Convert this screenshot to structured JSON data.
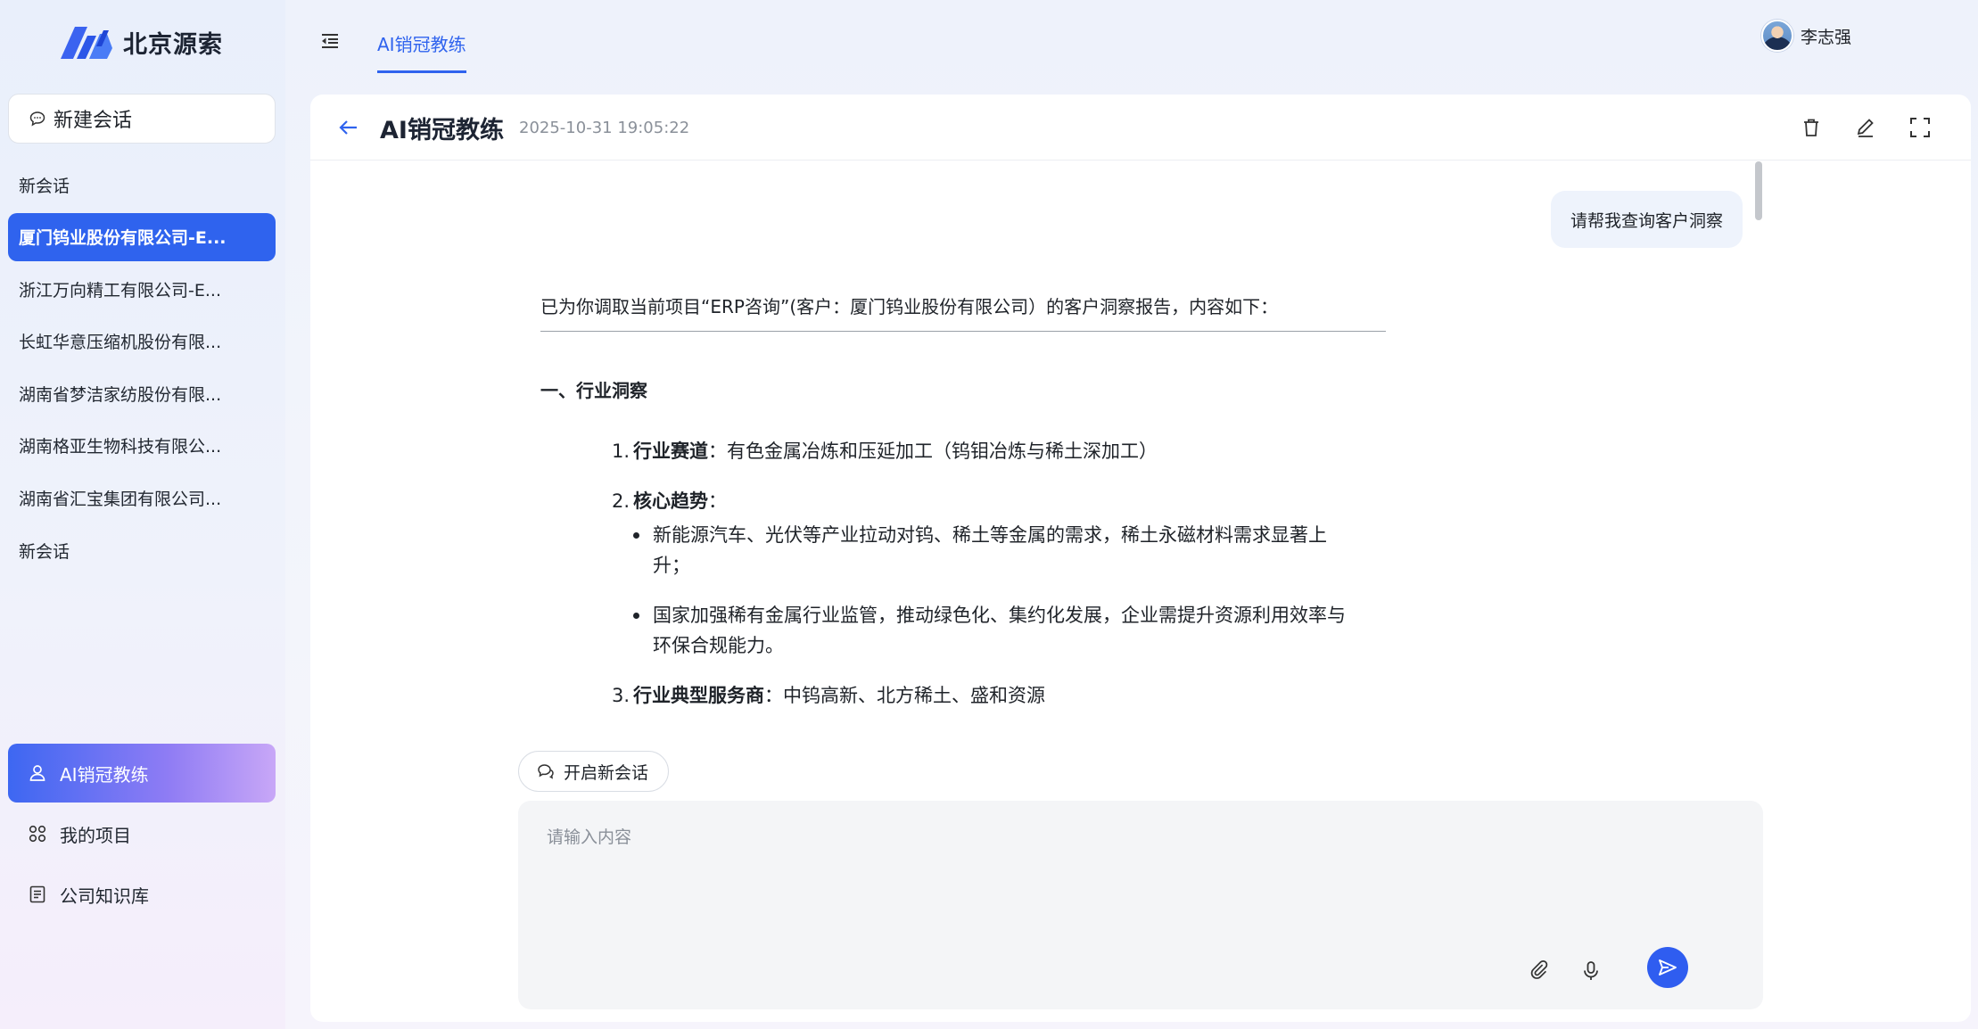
{
  "brand": {
    "name": "北京源索",
    "accent": "#2f63ee"
  },
  "sidebar": {
    "new_chat_label": "新建会话",
    "history": [
      {
        "label": "新会话",
        "active": false
      },
      {
        "label": "厦门钨业股份有限公司-E...",
        "active": true
      },
      {
        "label": "浙江万向精工有限公司-E...",
        "active": false
      },
      {
        "label": "长虹华意压缩机股份有限...",
        "active": false
      },
      {
        "label": "湖南省梦洁家纺股份有限...",
        "active": false
      },
      {
        "label": "湖南格亚生物科技有限公...",
        "active": false
      },
      {
        "label": "湖南省汇宝集团有限公司...",
        "active": false
      },
      {
        "label": "新会话",
        "active": false
      }
    ],
    "nav": [
      {
        "label": "AI销冠教练",
        "icon": "user-icon",
        "active": true
      },
      {
        "label": "我的项目",
        "icon": "grid-icon",
        "active": false
      },
      {
        "label": "公司知识库",
        "icon": "book-icon",
        "active": false
      }
    ]
  },
  "topbar": {
    "tab_label": "AI销冠教练",
    "user_name": "李志强"
  },
  "panel": {
    "title": "AI销冠教练",
    "timestamp": "2025-10-31 19:05:22"
  },
  "conversation": {
    "user_message": "请帮我查询客户洞察",
    "answer": {
      "intro": "已为你调取当前项目“ERP咨询”(客户：厦门钨业股份有限公司）的客户洞察报告，内容如下：",
      "section_title": "一、行业洞察",
      "items": [
        {
          "num": "1.",
          "label": "行业赛道",
          "text": "：有色金属冶炼和压延加工（钨钼冶炼与稀土深加工）"
        },
        {
          "num": "2.",
          "label": "核心趋势",
          "text": "：",
          "bullets": [
            "新能源汽车、光伏等产业拉动对钨、稀土等金属的需求，稀土永磁材料需求显著上升；",
            "国家加强稀有金属行业监管，推动绿色化、集约化发展，企业需提升资源利用效率与环保合规能力。"
          ]
        },
        {
          "num": "3.",
          "label": "行业典型服务商",
          "text": "：中钨高新、北方稀土、盛和资源"
        }
      ]
    }
  },
  "composer": {
    "restart_label": "开启新会话",
    "placeholder": "请输入内容"
  }
}
